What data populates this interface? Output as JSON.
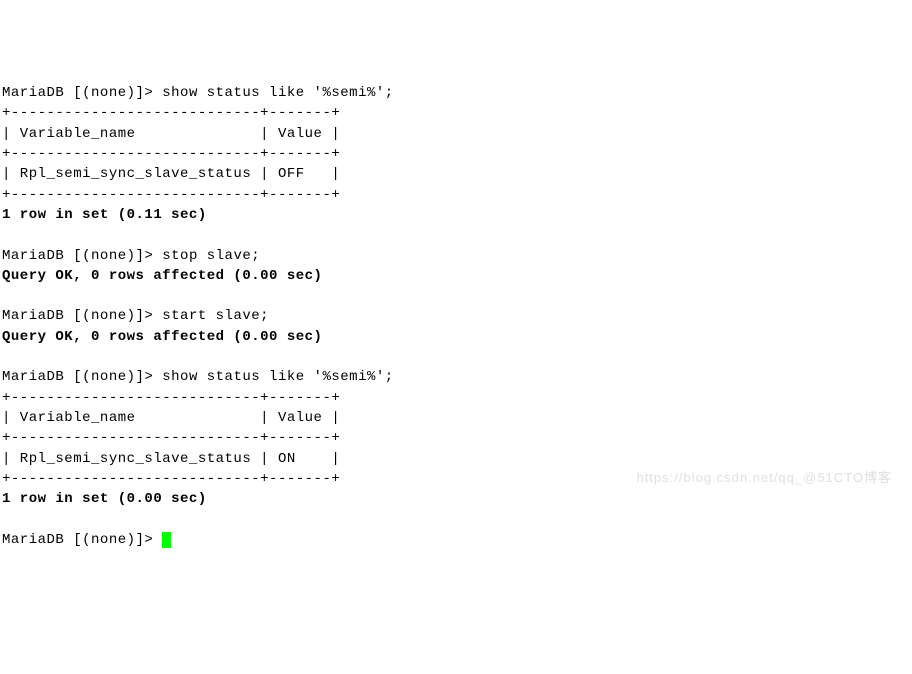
{
  "prompt": "MariaDB [(none)]> ",
  "queries": {
    "show_status_semi": "show status like '%semi%';",
    "stop_slave": "stop slave;",
    "start_slave": "start slave;"
  },
  "table_lines": {
    "border": "+----------------------------+-------+",
    "header": "| Variable_name              | Value |"
  },
  "table_rows": {
    "before": "| Rpl_semi_sync_slave_status | OFF   |",
    "after": "| Rpl_semi_sync_slave_status | ON    |"
  },
  "chart_data": [
    {
      "type": "table",
      "title": "show status like '%semi%' (before)",
      "columns": [
        "Variable_name",
        "Value"
      ],
      "rows": [
        [
          "Rpl_semi_sync_slave_status",
          "OFF"
        ]
      ]
    },
    {
      "type": "table",
      "title": "show status like '%semi%' (after)",
      "columns": [
        "Variable_name",
        "Value"
      ],
      "rows": [
        [
          "Rpl_semi_sync_slave_status",
          "ON"
        ]
      ]
    }
  ],
  "results": {
    "one_row_011": "1 row in set (0.11 sec)",
    "one_row_000": "1 row in set (0.00 sec)",
    "query_ok_000": "Query OK, 0 rows affected (0.00 sec)"
  },
  "watermark": "https://blog.csdn.net/qq_@51CTO博客"
}
